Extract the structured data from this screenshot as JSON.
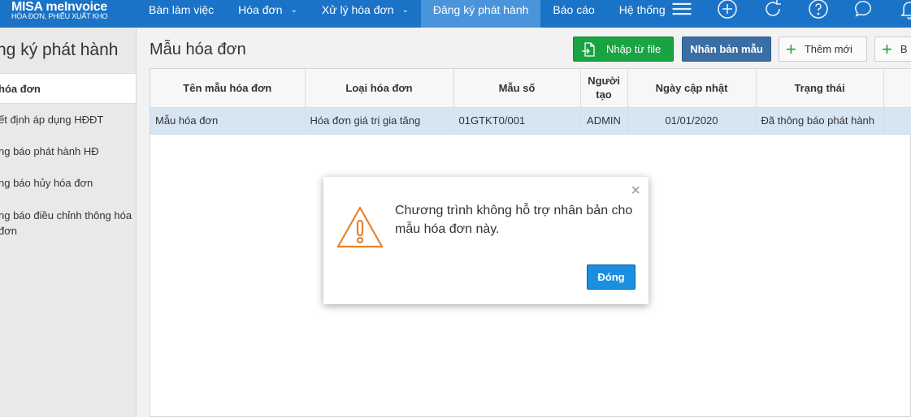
{
  "app": {
    "logo_main": "MISA meInvoice",
    "logo_sub": "HÓA ĐƠN, PHIẾU XUẤT KHO"
  },
  "nav": {
    "items": [
      {
        "label": "Bàn làm việc",
        "chevron": false
      },
      {
        "label": "Hóa đơn",
        "chevron": true
      },
      {
        "label": "Xử lý hóa đơn",
        "chevron": true
      },
      {
        "label": "Đăng ký phát hành",
        "chevron": false,
        "active": true
      },
      {
        "label": "Báo cáo",
        "chevron": false
      },
      {
        "label": "Hệ thống",
        "chevron": false
      }
    ],
    "icons": [
      "menu-icon",
      "add-circle-icon",
      "refresh-icon",
      "help-icon",
      "chat-icon",
      "bell-icon"
    ]
  },
  "sidebar": {
    "title": "ng ký phát hành",
    "items": [
      {
        "label": "hóa đơn",
        "selected": true
      },
      {
        "label": "ết định áp dụng HĐĐT"
      },
      {
        "label": "ng báo phát hành HĐ"
      },
      {
        "label": "ng báo hủy hóa đơn"
      },
      {
        "label": "ng báo điều chỉnh thông hóa đơn"
      }
    ]
  },
  "main": {
    "title": "Mẫu hóa đơn",
    "buttons": {
      "import": "Nhập từ file",
      "clone": "Nhân bản mẫu",
      "add": "Thêm mới",
      "more": "B"
    },
    "table": {
      "columns": [
        "Tên mẫu hóa đơn",
        "Loại hóa đơn",
        "Mẫu số",
        "Người tạo",
        "Ngày cập nhật",
        "Trạng thái",
        ""
      ],
      "rows": [
        [
          "Mẫu hóa đơn",
          "Hóa đơn giá trị gia tăng",
          "01GTKT0/001",
          "ADMIN",
          "01/01/2020",
          "Đã thông báo phát hành",
          ""
        ]
      ]
    }
  },
  "dialog": {
    "message": "Chương trình không hỗ trợ nhân bản cho mẫu hóa đơn này.",
    "close_symbol": "×",
    "button": "Đóng",
    "icon": "warning-icon"
  },
  "colors": {
    "nav_bg": "#1a73c6",
    "nav_active": "#4a94db",
    "import_green": "#1aa343",
    "clone_blue": "#3a6ea5",
    "dialog_btn": "#1a8fe0",
    "warning_orange": "#e8822a",
    "row_selected": "#d6e5f2"
  }
}
